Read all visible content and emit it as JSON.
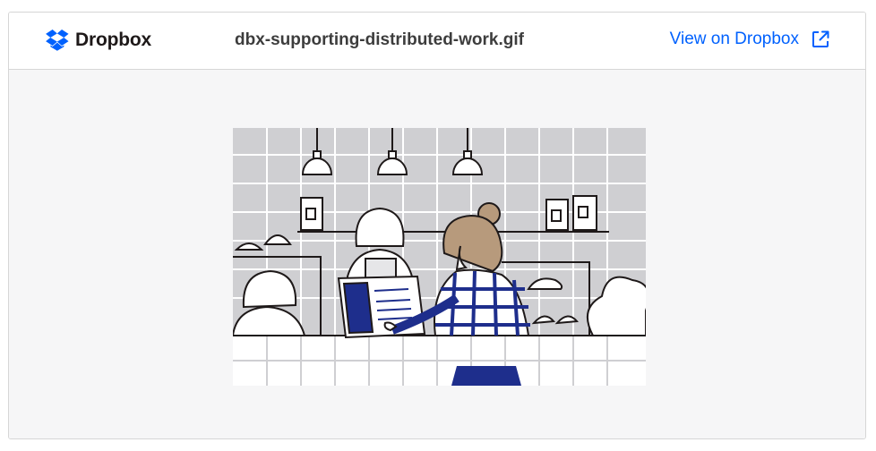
{
  "header": {
    "logo_label": "Dropbox",
    "filename": "dbx-supporting-distributed-work.gif",
    "view_link_label": "View on Dropbox",
    "view_link_icon": "external-link-icon",
    "logo_icon": "dropbox-logo-icon"
  },
  "preview": {
    "kind": "illustration",
    "subject_icon": "cafe-illustration"
  },
  "colors": {
    "brand_blue": "#0061fe",
    "navy": "#1e2e8c",
    "hair": "#b79a7c",
    "text_dark": "#1e1919",
    "text_mid": "#3d3d3d",
    "border": "#d6d6d6",
    "preview_bg": "#f6f6f7",
    "tile_bg": "#cfcfd2"
  }
}
